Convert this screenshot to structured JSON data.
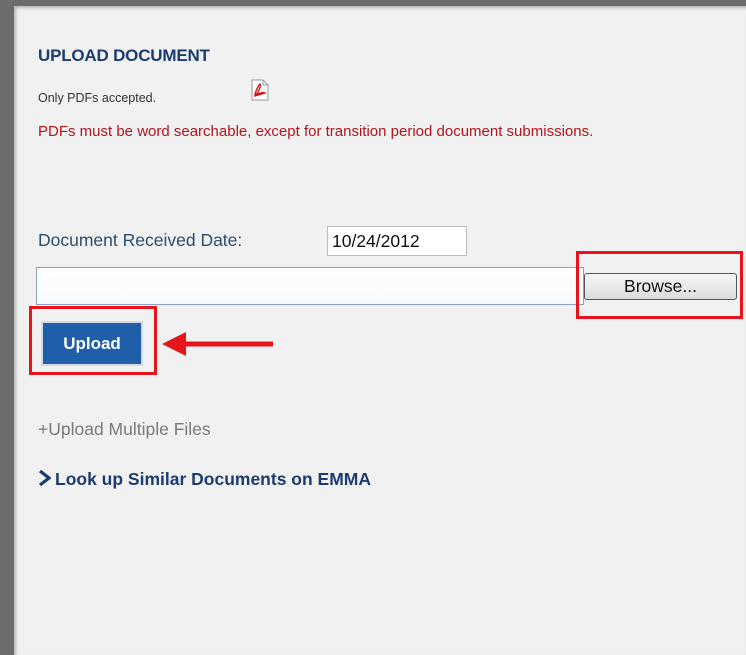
{
  "upload": {
    "title": "UPLOAD DOCUMENT",
    "pdf_note": "Only PDFs accepted.",
    "pdf_icon": "pdf-file-icon",
    "warning": "PDFs must be word searchable, except for transition period document submissions."
  },
  "date": {
    "label": "Document Received Date:",
    "value": "10/24/2012"
  },
  "file": {
    "browse_label": "Browse..."
  },
  "actions": {
    "upload_label": "Upload",
    "multi_label": "+Upload Multiple Files",
    "emma_label": "Look up Similar Documents on EMMA",
    "emma_icon": "chevron-right-icon"
  },
  "colors": {
    "title": "#1c3b6e",
    "warning": "#b0141c",
    "upload_button": "#1f5ea8",
    "highlight": "#e8141c"
  }
}
